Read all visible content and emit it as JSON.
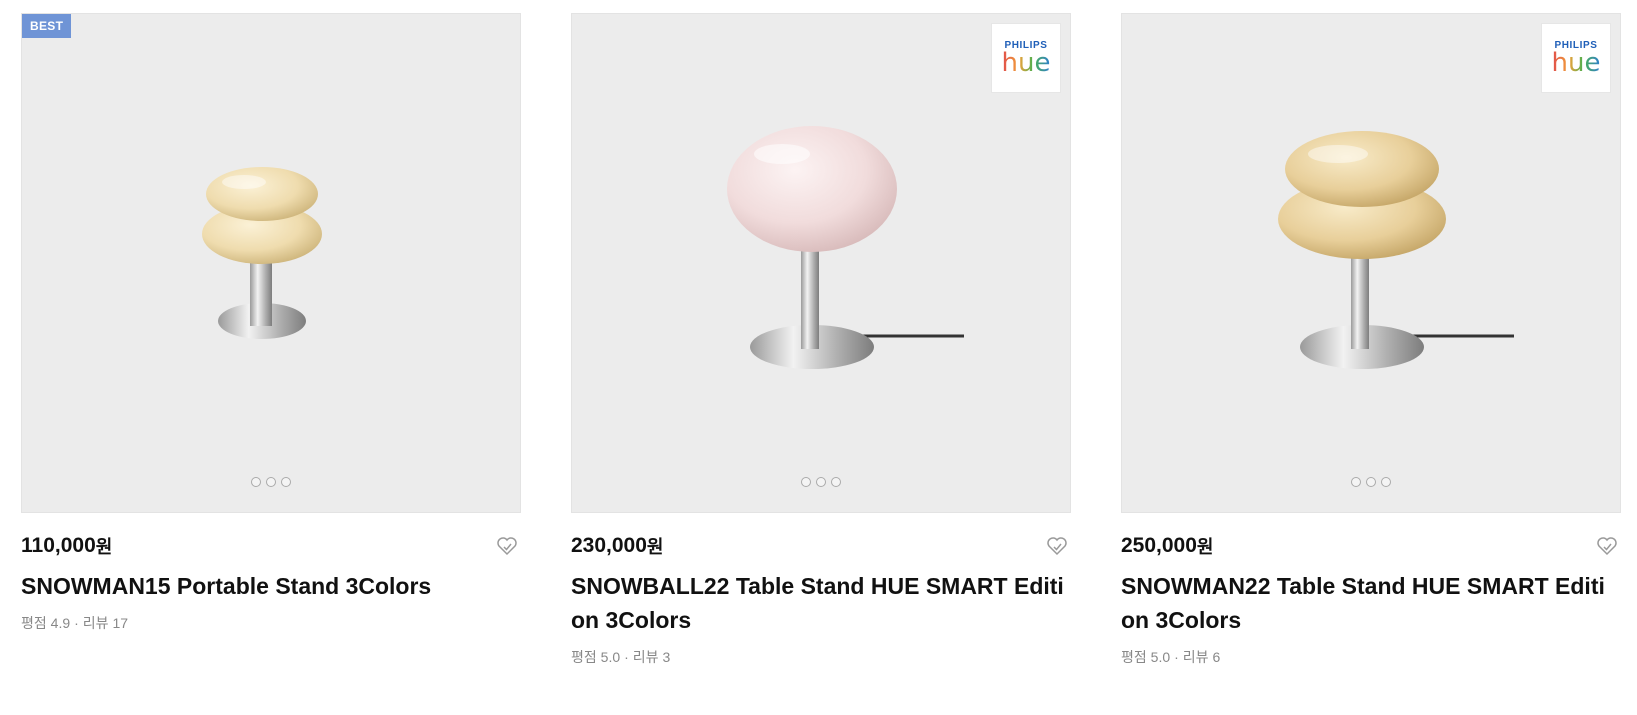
{
  "products": [
    {
      "badge": "BEST",
      "price": "110,000",
      "currency": "원",
      "title": "SNOWMAN15 Portable Stand 3Colors",
      "rating_label": "평점",
      "rating": "4.9",
      "review_label": "리뷰",
      "review_count": "17",
      "image_dots": 3,
      "shade_color": "#efdcae"
    },
    {
      "brand_logo": {
        "line1": "PHILIPS",
        "line2": "hue"
      },
      "price": "230,000",
      "currency": "원",
      "title": "SNOWBALL22 Table Stand HUE SMART Edition 3Colors",
      "rating_label": "평점",
      "rating": "5.0",
      "review_label": "리뷰",
      "review_count": "3",
      "image_dots": 3,
      "shade_color": "#f1dcdc"
    },
    {
      "brand_logo": {
        "line1": "PHILIPS",
        "line2": "hue"
      },
      "price": "250,000",
      "currency": "원",
      "title": "SNOWMAN22 Table Stand HUE SMART Edition 3Colors",
      "rating_label": "평점",
      "rating": "5.0",
      "review_label": "리뷰",
      "review_count": "6",
      "image_dots": 3,
      "shade_color": "#e8cf9a"
    }
  ],
  "icons": {
    "wish": "heart-outline-icon",
    "dots": "carousel-dot-icon"
  }
}
